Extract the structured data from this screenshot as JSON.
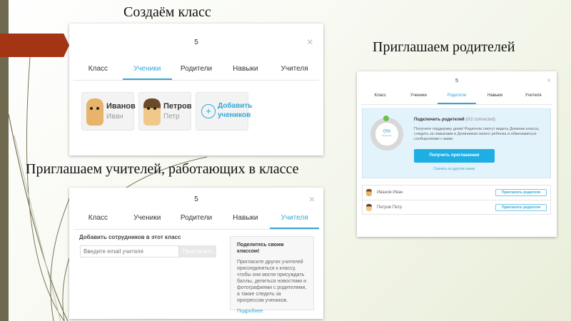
{
  "captions": {
    "create": "Создаём класс",
    "parents": "Приглашаем родителей",
    "teachers": "Приглашаем учителей, работающих в классе"
  },
  "tabs": [
    "Класс",
    "Ученики",
    "Родители",
    "Навыки",
    "Учителя"
  ],
  "class_name": "5",
  "close_icon": "×",
  "students": [
    {
      "last": "Иванов",
      "first": "Иван"
    },
    {
      "last": "Петров",
      "first": "Петр"
    }
  ],
  "add_students": {
    "line1": "Добавить",
    "line2": "учеников",
    "icon": "+"
  },
  "teachers_panel": {
    "heading": "Добавить сотрудников в этот класс",
    "email_placeholder": "Введите email учителя",
    "invite_button": "Пригласить",
    "share_title": "Поделитесь своим классом!",
    "share_text": "Пригласите других учителей присоединиться к классу, чтобы они могли присуждать баллы, делиться новостями и фотографиями с родителями, а также следить за прогрессом учеников.",
    "more_link": "Подробнее"
  },
  "parents_panel": {
    "progress_percent": 0,
    "progress_label": "0%",
    "progress_sub": "Родители",
    "title": "Подключить родителей",
    "connected": "(0/2 connected)",
    "text": "Получите поддержку дома! Родители смогут видеть Дневник класса, следить за навыками и Дневником своего ребенка и обмениваться сообщениями с вами.",
    "get_invites": "Получить приглашения",
    "other_lang": "Скачать на другом языке",
    "rows": [
      {
        "name": "Иванов Иван",
        "button": "Пригласить родителя"
      },
      {
        "name": "Петров Петр",
        "button": "Пригласить родителя"
      }
    ]
  },
  "colors": {
    "accent": "#2fa8d8",
    "sidebar": "#6f6a4f",
    "tab_red": "#a33514"
  }
}
